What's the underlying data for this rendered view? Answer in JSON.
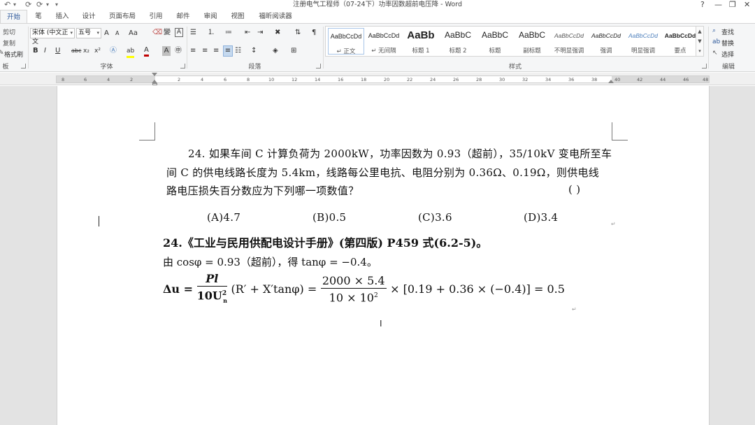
{
  "window": {
    "title": "注册电气工程师（07-24下）功率因数超前电压降 - Word",
    "help_label": "?",
    "minimize_label": "—",
    "restore_label": "❐",
    "close_label": "✕"
  },
  "quick_access": {
    "undo": "↶",
    "redo": "⟳",
    "customize": "▾"
  },
  "tabs": [
    {
      "label": "开始",
      "active": true
    },
    {
      "label": "笔"
    },
    {
      "label": "插入"
    },
    {
      "label": "设计"
    },
    {
      "label": "页面布局"
    },
    {
      "label": "引用"
    },
    {
      "label": "邮件"
    },
    {
      "label": "审阅"
    },
    {
      "label": "视图"
    },
    {
      "label": "福昕阅读器"
    }
  ],
  "clipboard": {
    "cut": "剪切",
    "copy": "复制",
    "format_painter": "格式刷",
    "label": "板"
  },
  "font": {
    "family": "宋体 (中文正文",
    "size": "五号",
    "label": "字体",
    "grow": "A",
    "shrink": "A",
    "case": "Aa",
    "bold": "B",
    "italic": "I",
    "underline": "U",
    "strike": "abc",
    "subscript": "x₂",
    "superscript": "x²",
    "font_color_letter": "A",
    "highlight_letter": "ab"
  },
  "paragraph": {
    "label": "段落"
  },
  "styles": {
    "label": "样式",
    "items": [
      {
        "preview": "AaBbCcDd",
        "name": "↵ 正文",
        "selected": true
      },
      {
        "preview": "AaBbCcDd",
        "name": "↵ 无间隔"
      },
      {
        "preview": "AaBb",
        "name": "标题 1"
      },
      {
        "preview": "AaBbC",
        "name": "标题 2"
      },
      {
        "preview": "AaBbC",
        "name": "标题"
      },
      {
        "preview": "AaBbC",
        "name": "副标题"
      },
      {
        "preview": "AaBbCcDd",
        "name": "不明显强调"
      },
      {
        "preview": "AaBbCcDd",
        "name": "强调"
      },
      {
        "preview": "AaBbCcDd",
        "name": "明显强调"
      },
      {
        "preview": "AaBbCcDd",
        "name": "要点"
      }
    ]
  },
  "editing": {
    "find": "查找",
    "replace": "替换",
    "select": "选择",
    "label": "编辑"
  },
  "ruler": {
    "ticks_left": [
      "8",
      "6",
      "4",
      "2"
    ],
    "ticks_right": [
      "2",
      "4",
      "6",
      "8",
      "10",
      "12",
      "14",
      "16",
      "18",
      "20",
      "22",
      "24",
      "26",
      "28",
      "30",
      "32",
      "34",
      "36",
      "38",
      "40",
      "42",
      "44",
      "46",
      "48"
    ]
  },
  "document": {
    "question_line1": "24. 如果车间 C 计算负荷为 2000kW，功率因数为 0.93（超前），35/10kV 变电所至车",
    "question_line2": "间 C 的供电线路长度为 5.4km，线路每公里电抗、电阻分别为 0.36Ω、0.19Ω，则供电线",
    "question_line3": "路电压损失百分数应为下列哪一项数值？",
    "paren": "(        )",
    "options": [
      "(A)4.7",
      "(B)0.5",
      "(C)3.6",
      "(D)3.4"
    ],
    "answer_line1": "24.《工业与民用供配电设计手册》(第四版) P459 式(6.2-5)。",
    "answer_line2": "由 cosφ = 0.93（超前），得 tanφ = −0.4。",
    "formula": {
      "lhs": "Δu =",
      "f1_num": "Pl",
      "f1_den": "10U",
      "f1_den_sub": "n",
      "f1_den_sup": "2",
      "mid": "(R′ + X′tanφ) =",
      "f2_num": "2000 × 5.4",
      "f2_den": "10 × 10",
      "f2_den_sup": "2",
      "rhs": "× [0.19 + 0.36 × (−0.4)] = 0.5"
    },
    "para_mark": "↵"
  }
}
